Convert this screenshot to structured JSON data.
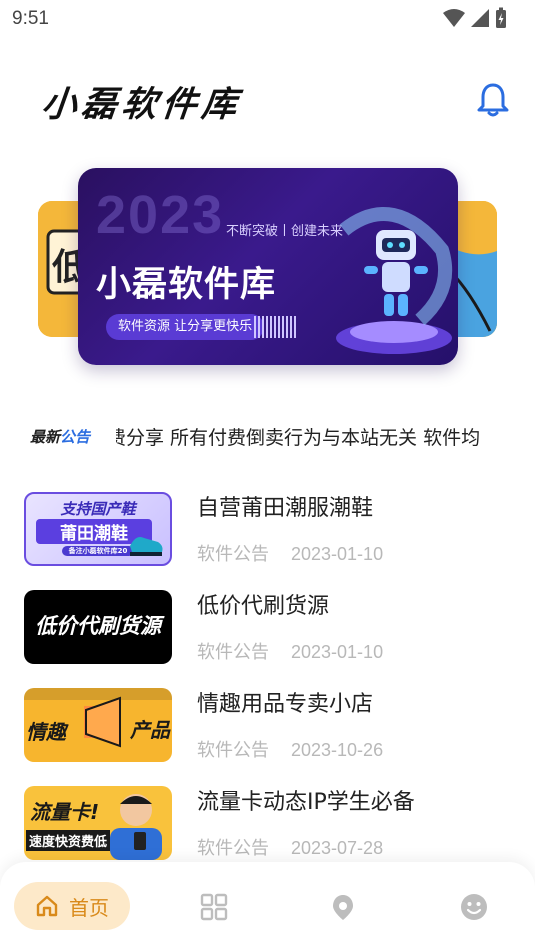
{
  "status_bar": {
    "time": "9:51"
  },
  "header": {
    "logo_text": "小磊软件库"
  },
  "banner": {
    "year": "2023",
    "slogan": "不断突破丨创建未来",
    "title": "小磊软件库",
    "tag": "软件资源  让分享更快乐",
    "left_peek_text": "低",
    "right_peek_text": ""
  },
  "notice": {
    "badge_prefix": "最新",
    "badge_suffix": "公告",
    "text": "免费分享 所有付费倒卖行为与本站无关 软件均"
  },
  "list": [
    {
      "title": "自营莆田潮服潮鞋",
      "category": "软件公告",
      "date": "2023-01-10",
      "thumb_line1": "支持国产鞋",
      "thumb_line2": "莆田潮鞋",
      "thumb_line3": "备注小磊软件库20"
    },
    {
      "title": "低价代刷货源",
      "category": "软件公告",
      "date": "2023-01-10",
      "thumb_line1": "低价代刷货源"
    },
    {
      "title": "情趣用品专卖小店",
      "category": "软件公告",
      "date": "2023-10-26",
      "thumb_line1": "情趣",
      "thumb_line2": "产品"
    },
    {
      "title": "流量卡动态IP学生必备",
      "category": "软件公告",
      "date": "2023-07-28",
      "thumb_line1": "流量卡!",
      "thumb_line2": "速度快资费低"
    }
  ],
  "bottom_nav": {
    "home_label": "首页",
    "items": [
      "home-icon",
      "grid-icon",
      "discover-icon",
      "smile-icon"
    ],
    "active_color": "#d98a1a",
    "inactive_color": "#bdbdbd"
  },
  "colors": {
    "accent_blue": "#2b6de0",
    "banner_bg": "#2a1060"
  }
}
